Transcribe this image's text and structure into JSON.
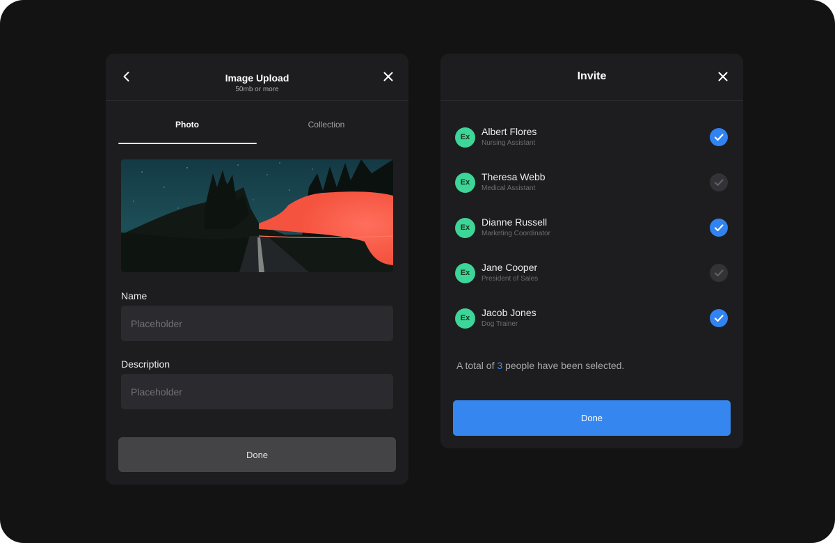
{
  "colors": {
    "background": "#131314",
    "panel": "#1d1d20",
    "accent_blue": "#3083f0",
    "avatar_green": "#3dd598",
    "done_grey": "#444447"
  },
  "upload": {
    "back_icon": "chevron-left-icon",
    "close_icon": "close-icon",
    "title": "Image Upload",
    "subtitle": "50mb or more",
    "tabs": [
      {
        "label": "Photo",
        "active": true
      },
      {
        "label": "Collection",
        "active": false
      }
    ],
    "photo_alt": "Night road with red light trail",
    "name_label": "Name",
    "name_placeholder": "Placeholder",
    "description_label": "Description",
    "description_placeholder": "Placeholder",
    "done_label": "Done"
  },
  "invite": {
    "title": "Invite",
    "close_icon": "close-icon",
    "people": [
      {
        "initials": "Ex",
        "name": "Albert Flores",
        "role": "Nursing Assistant",
        "selected": true
      },
      {
        "initials": "Ex",
        "name": "Theresa Webb",
        "role": "Medical Assistant",
        "selected": false
      },
      {
        "initials": "Ex",
        "name": "Dianne Russell",
        "role": "Marketing Coordinator",
        "selected": true
      },
      {
        "initials": "Ex",
        "name": "Jane Cooper",
        "role": "President of Sales",
        "selected": false
      },
      {
        "initials": "Ex",
        "name": "Jacob Jones",
        "role": "Dog Trainer",
        "selected": true
      }
    ],
    "summary_prefix": "A total of ",
    "summary_count": "3",
    "summary_suffix": " people have been selected.",
    "done_label": "Done"
  }
}
